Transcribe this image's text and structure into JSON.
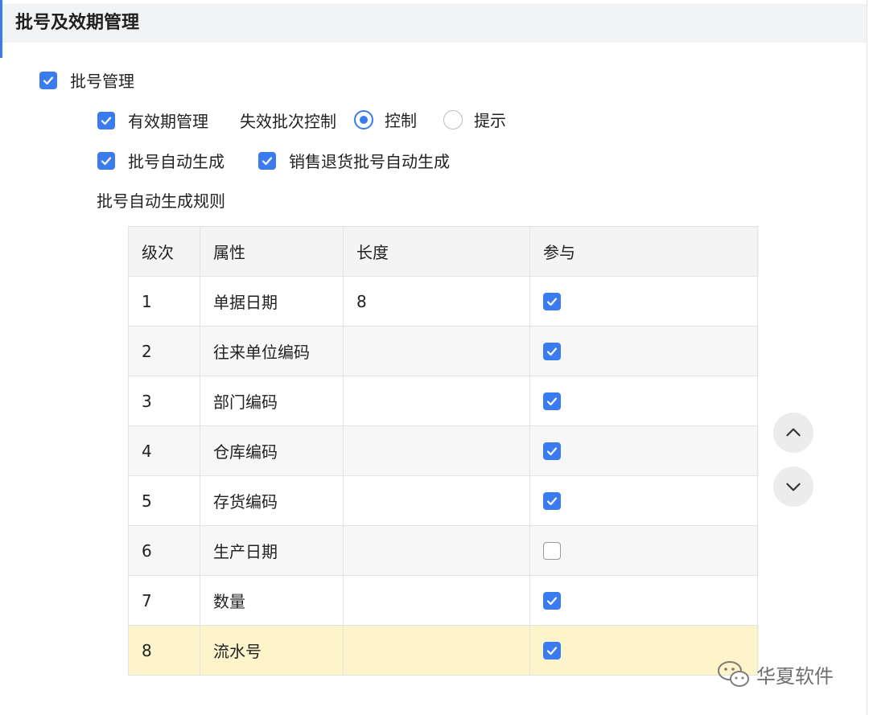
{
  "section": {
    "title": "批号及效期管理"
  },
  "options": {
    "batch_mgmt": {
      "label": "批号管理",
      "checked": true
    },
    "expiry_mgmt": {
      "label": "有效期管理",
      "checked": true
    },
    "invalid_batch_control": {
      "label": "失效批次控制"
    },
    "radio_control": {
      "label": "控制",
      "selected": true
    },
    "radio_prompt": {
      "label": "提示",
      "selected": false
    },
    "auto_batch": {
      "label": "批号自动生成",
      "checked": true
    },
    "return_auto_batch": {
      "label": "销售退货批号自动生成",
      "checked": true
    },
    "rule_title": "批号自动生成规则"
  },
  "table": {
    "headers": [
      "级次",
      "属性",
      "长度",
      "参与"
    ],
    "rows": [
      {
        "level": "1",
        "attr": "单据日期",
        "length": "8",
        "participate": true
      },
      {
        "level": "2",
        "attr": "往来单位编码",
        "length": "",
        "participate": true
      },
      {
        "level": "3",
        "attr": "部门编码",
        "length": "",
        "participate": true
      },
      {
        "level": "4",
        "attr": "仓库编码",
        "length": "",
        "participate": true
      },
      {
        "level": "5",
        "attr": "存货编码",
        "length": "",
        "participate": true
      },
      {
        "level": "6",
        "attr": "生产日期",
        "length": "",
        "participate": false
      },
      {
        "level": "7",
        "attr": "数量",
        "length": "",
        "participate": true
      },
      {
        "level": "8",
        "attr": "流水号",
        "length": "",
        "participate": true
      }
    ],
    "selected_row": 8
  },
  "icons": {
    "move_up": "chevron-up-icon",
    "move_down": "chevron-down-icon",
    "watermark": "wechat-icon"
  },
  "watermark": {
    "text": "华夏软件"
  },
  "colors": {
    "accent": "#3a7bf0",
    "highlight_row": "#fdf4cc",
    "header_bg": "#f2f3f5"
  }
}
